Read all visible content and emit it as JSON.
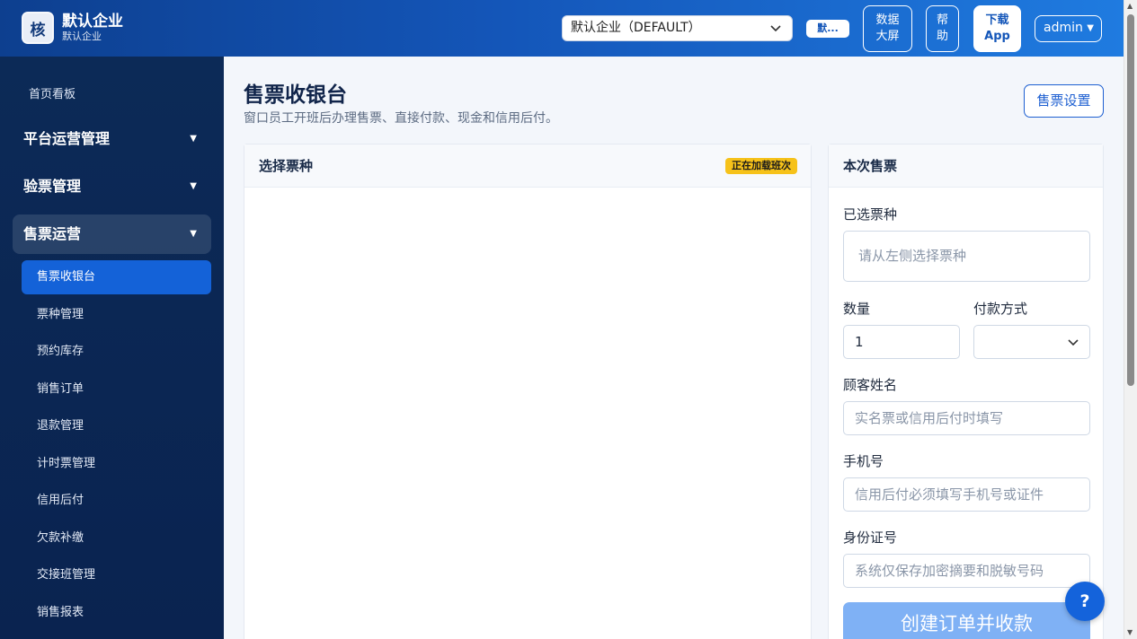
{
  "header": {
    "logo_char": "核",
    "brand_name": "默认企业",
    "brand_sub": "默认企业",
    "enterprise_select": "默认企业（DEFAULT）",
    "enterprise_chip": "默...",
    "data_screen": "数据\n大屏",
    "help": "帮\n助",
    "download_app": "下载\nApp",
    "user": "admin"
  },
  "sidebar": {
    "home": "首页看板",
    "groups": [
      "平台运营管理",
      "验票管理",
      "售票运营"
    ],
    "items": [
      "售票收银台",
      "票种管理",
      "预约库存",
      "销售订单",
      "退款管理",
      "计时票管理",
      "信用后付",
      "欠款补缴",
      "交接班管理",
      "销售报表"
    ],
    "active_item": "售票收银台"
  },
  "main": {
    "title": "售票收银台",
    "description": "窗口员工开班后办理售票、直接付款、现金和信用后付。",
    "settings_button": "售票设置",
    "left_card": {
      "title": "选择票种",
      "badge": "正在加载班次"
    },
    "right_card": {
      "title": "本次售票",
      "selected_label": "已选票种",
      "selected_placeholder": "请从左侧选择票种",
      "qty_label": "数量",
      "qty_value": "1",
      "pay_label": "付款方式",
      "pay_value": "",
      "name_label": "顾客姓名",
      "name_placeholder": "实名票或信用后付时填写",
      "phone_label": "手机号",
      "phone_placeholder": "信用后付必须填写手机号或证件",
      "id_label": "身份证号",
      "id_placeholder": "系统仅保存加密摘要和脱敏号码",
      "submit": "创建订单并收款"
    }
  },
  "help_fab": "?",
  "colors": {
    "header_start": "#0d3f8f",
    "header_end": "#1f7be0",
    "sidebar_bg": "#0c2a57",
    "active_item": "#1462d8",
    "primary": "#1d5fd1",
    "badge": "#f6c21a",
    "submit_disabled": "#7fb1f5"
  }
}
